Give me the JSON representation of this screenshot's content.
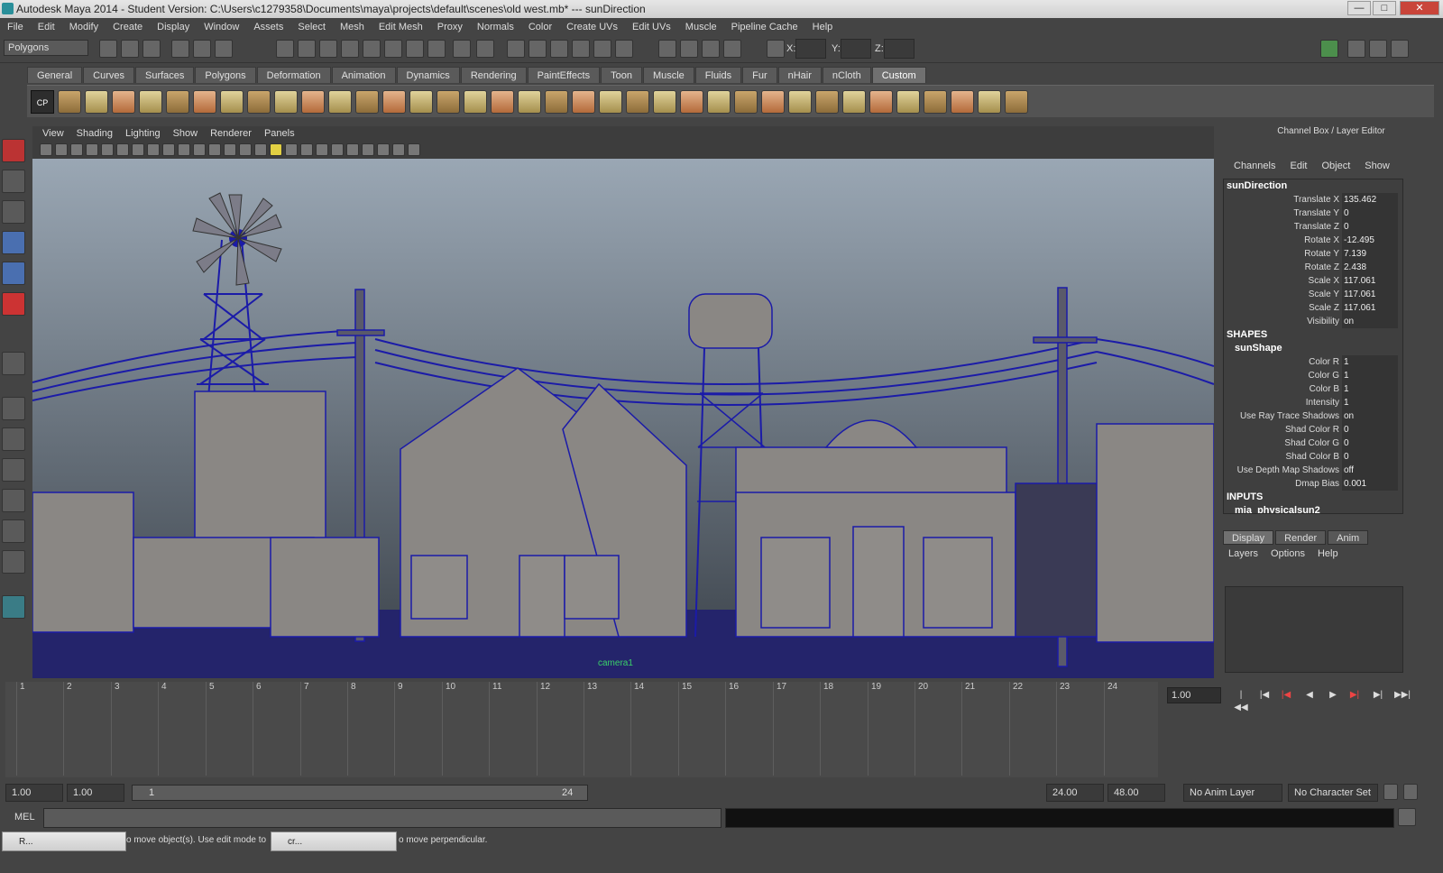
{
  "window": {
    "title": "Autodesk Maya 2014 - Student Version: C:\\Users\\c1279358\\Documents\\maya\\projects\\default\\scenes\\old west.mb*   ---   sunDirection",
    "min": "—",
    "max": "□",
    "close": "✕"
  },
  "menu": [
    "File",
    "Edit",
    "Modify",
    "Create",
    "Display",
    "Window",
    "Assets",
    "Select",
    "Mesh",
    "Edit Mesh",
    "Proxy",
    "Normals",
    "Color",
    "Create UVs",
    "Edit UVs",
    "Muscle",
    "Pipeline Cache",
    "Help"
  ],
  "status": {
    "mode": "Polygons",
    "x_label": "X:",
    "y_label": "Y:",
    "z_label": "Z:"
  },
  "shelf": {
    "tabs": [
      "General",
      "Curves",
      "Surfaces",
      "Polygons",
      "Deformation",
      "Animation",
      "Dynamics",
      "Rendering",
      "PaintEffects",
      "Toon",
      "Muscle",
      "Fluids",
      "Fur",
      "nHair",
      "nCloth",
      "Custom"
    ],
    "active": "Custom",
    "cp_label": "CP"
  },
  "viewport": {
    "menu": [
      "View",
      "Shading",
      "Lighting",
      "Show",
      "Renderer",
      "Panels"
    ],
    "camera": "camera1"
  },
  "channel_box": {
    "title": "Channel Box / Layer Editor",
    "menu": [
      "Channels",
      "Edit",
      "Object",
      "Show"
    ],
    "object": "sunDirection",
    "attrs": [
      {
        "name": "Translate X",
        "value": "135.462"
      },
      {
        "name": "Translate Y",
        "value": "0"
      },
      {
        "name": "Translate Z",
        "value": "0"
      },
      {
        "name": "Rotate X",
        "value": "-12.495"
      },
      {
        "name": "Rotate Y",
        "value": "7.139"
      },
      {
        "name": "Rotate Z",
        "value": "2.438"
      },
      {
        "name": "Scale X",
        "value": "117.061"
      },
      {
        "name": "Scale Y",
        "value": "117.061"
      },
      {
        "name": "Scale Z",
        "value": "117.061"
      },
      {
        "name": "Visibility",
        "value": "on"
      }
    ],
    "shapes_header": "SHAPES",
    "shape": "sunShape",
    "shape_attrs": [
      {
        "name": "Color R",
        "value": "1"
      },
      {
        "name": "Color G",
        "value": "1"
      },
      {
        "name": "Color B",
        "value": "1"
      },
      {
        "name": "Intensity",
        "value": "1"
      },
      {
        "name": "Use Ray Trace Shadows",
        "value": "on"
      },
      {
        "name": "Shad Color R",
        "value": "0"
      },
      {
        "name": "Shad Color G",
        "value": "0"
      },
      {
        "name": "Shad Color B",
        "value": "0"
      },
      {
        "name": "Use Depth Map Shadows",
        "value": "off"
      },
      {
        "name": "Dmap Bias",
        "value": "0.001"
      }
    ],
    "inputs_header": "INPUTS",
    "input": "mia_physicalsun2"
  },
  "layer_editor": {
    "tabs": [
      "Display",
      "Render",
      "Anim"
    ],
    "active": "Display",
    "menu": [
      "Layers",
      "Options",
      "Help"
    ]
  },
  "timeline": {
    "frames": [
      "1",
      "2",
      "3",
      "4",
      "5",
      "6",
      "7",
      "8",
      "9",
      "10",
      "11",
      "12",
      "13",
      "14",
      "15",
      "16",
      "17",
      "18",
      "19",
      "20",
      "21",
      "22",
      "23",
      "24"
    ],
    "current": "1.00"
  },
  "range": {
    "start": "1.00",
    "playback_start": "1.00",
    "slider_start": "1",
    "slider_end": "24",
    "playback_end": "24.00",
    "end": "48.00",
    "anim_layer": "No Anim Layer",
    "char_set": "No Character Set"
  },
  "mel": {
    "label": "MEL"
  },
  "taskbar": {
    "item1": "R...",
    "item2": "cr...",
    "help1": "o move object(s). Use edit mode to",
    "help2": "o move perpendicular."
  },
  "colors": {
    "bg": "#444444",
    "sky_top": "#9aa7b4",
    "sky_bottom": "#3a4149",
    "wire": "#1b1ba8",
    "building": "#8a8784"
  }
}
